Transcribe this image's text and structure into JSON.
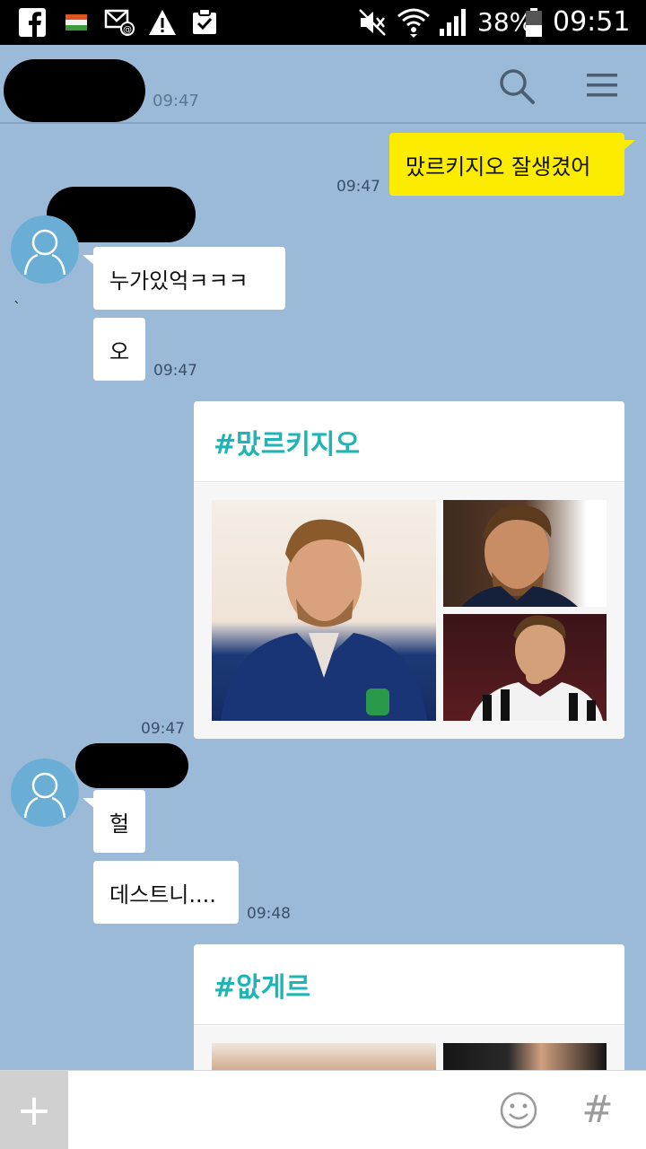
{
  "status_bar": {
    "battery_text": "38%",
    "clock": "09:51",
    "icons": [
      "facebook-icon",
      "flag-icon",
      "email-icon",
      "warning-icon",
      "clipboard-check-icon",
      "mute-icon",
      "wifi-icon",
      "signal-icon",
      "battery-icon"
    ]
  },
  "header": {
    "contact_name": "",
    "time_behind": "09:47",
    "icons": [
      "search-icon",
      "menu-icon"
    ]
  },
  "messages": [
    {
      "from": "me",
      "text": "맜르키지오 잘생겼어",
      "time": "09:47"
    },
    {
      "from": "other",
      "text": "누가있억ㅋㅋㅋ"
    },
    {
      "from": "other",
      "text": "오",
      "time": "09:47"
    },
    {
      "from": "other",
      "stray_mark": "`"
    },
    {
      "from": "me",
      "card_title": "#맜르키지오",
      "time": "09:47"
    },
    {
      "from": "other",
      "text": "헐"
    },
    {
      "from": "other",
      "text": "데스트니....",
      "time": "09:48"
    },
    {
      "from": "me",
      "card_title": "#앖게르"
    }
  ],
  "input_bar": {
    "plus_label": "+",
    "hash_label": "#",
    "icons": [
      "plus-icon",
      "emoji-icon",
      "hashtag-icon"
    ]
  },
  "colors": {
    "chat_background": "#9bbad8",
    "my_bubble": "#fcec00",
    "other_bubble": "#ffffff",
    "hashtag_accent": "#1fb5b5",
    "avatar": "#6aaed6"
  }
}
